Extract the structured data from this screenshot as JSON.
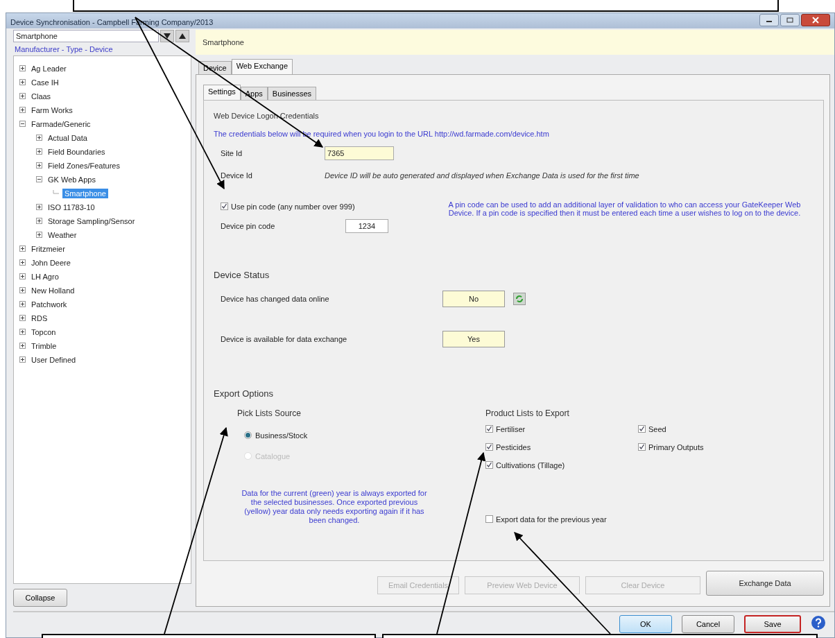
{
  "window": {
    "title": "Device Synchronisation - Campbell Farming Company/2013"
  },
  "sidebar": {
    "device_combo": {
      "value": "Smartphone"
    },
    "heading": "Manufacturer - Type - Device",
    "tree": [
      {
        "label": "Ag Leader",
        "expanded": false,
        "selected": false
      },
      {
        "label": "Case IH",
        "expanded": false,
        "selected": false
      },
      {
        "label": "Claas",
        "expanded": false,
        "selected": false
      },
      {
        "label": "Farm Works",
        "expanded": false,
        "selected": false
      },
      {
        "label": "Farmade/Generic",
        "expanded": true,
        "selected": false,
        "children": [
          {
            "label": "Actual Data",
            "expanded": false,
            "selected": false
          },
          {
            "label": "Field Boundaries",
            "expanded": false,
            "selected": false
          },
          {
            "label": "Field Zones/Features",
            "expanded": false,
            "selected": false
          },
          {
            "label": "GK Web Apps",
            "expanded": true,
            "selected": false,
            "children": [
              {
                "label": "Smartphone",
                "selected": true
              }
            ]
          },
          {
            "label": "ISO 11783-10",
            "expanded": false,
            "selected": false
          },
          {
            "label": "Storage Sampling/Sensor",
            "expanded": false,
            "selected": false
          },
          {
            "label": "Weather",
            "expanded": false,
            "selected": false
          }
        ]
      },
      {
        "label": "Fritzmeier",
        "expanded": false,
        "selected": false
      },
      {
        "label": "John Deere",
        "expanded": false,
        "selected": false
      },
      {
        "label": "LH Agro",
        "expanded": false,
        "selected": false
      },
      {
        "label": "New Holland",
        "expanded": false,
        "selected": false
      },
      {
        "label": "Patchwork",
        "expanded": false,
        "selected": false
      },
      {
        "label": "RDS",
        "expanded": false,
        "selected": false
      },
      {
        "label": "Topcon",
        "expanded": false,
        "selected": false
      },
      {
        "label": "Trimble",
        "expanded": false,
        "selected": false
      },
      {
        "label": "User Defined",
        "expanded": false,
        "selected": false
      }
    ],
    "collapse_button": "Collapse"
  },
  "header": {
    "title": "Smartphone"
  },
  "tabs": [
    {
      "label": "Device",
      "selected": false
    },
    {
      "label": "Web Exchange",
      "selected": true
    }
  ],
  "sub_tabs": [
    {
      "label": "Settings",
      "selected": true
    },
    {
      "label": "Apps",
      "selected": false
    },
    {
      "label": "Businesses",
      "selected": false
    }
  ],
  "credentials": {
    "title": "Web Device Logon Credentials",
    "note": "The credentials below will be required when you login to the URL http://wd.farmade.com/device.htm",
    "site_id": {
      "label": "Site Id",
      "value": "7365"
    },
    "device_id": {
      "label": "Device Id",
      "note": "Device ID will be auto generated and displayed when Exchange Data is used for the first time"
    },
    "use_pin": {
      "label": "Use pin code (any number over 999)",
      "checked": true
    },
    "pin": {
      "label": "Device pin code",
      "value": "1234"
    },
    "pin_note": "A pin code can be used to add an additional layer of validation to who can access your GateKeeper Web Device. If a pin code is specified then it must be entered each time a user wishes to log on to the device."
  },
  "device_status": {
    "title": "Device Status",
    "rows": [
      {
        "label": "Device has changed data online",
        "value": "No",
        "refresh": true
      },
      {
        "label": "Device is available for data exchange",
        "value": "Yes",
        "refresh": false
      }
    ]
  },
  "export_options": {
    "title": "Export Options",
    "pick_lists": {
      "title": "Pick Lists Source",
      "options": [
        {
          "label": "Business/Stock",
          "selected": true,
          "disabled": false
        },
        {
          "label": "Catalogue",
          "selected": false,
          "disabled": true
        }
      ]
    },
    "note": "Data for the current (green) year is always exported for the selected businesses. Once exported previous (yellow) year data only needs exporting again if it has been changed.",
    "product_lists": {
      "title": "Product Lists to Export",
      "items": [
        {
          "label": "Fertiliser",
          "checked": true
        },
        {
          "label": "Seed",
          "checked": true
        },
        {
          "label": "Pesticides",
          "checked": true
        },
        {
          "label": "Primary Outputs",
          "checked": true
        },
        {
          "label": "Cultivations (Tillage)",
          "checked": true
        }
      ]
    },
    "previous_year": {
      "label": "Export data for the previous year",
      "checked": false
    }
  },
  "actions": [
    {
      "label": "Email Credentials",
      "disabled": true
    },
    {
      "label": "Preview Web Device",
      "disabled": true
    },
    {
      "label": "Clear Device",
      "disabled": true
    },
    {
      "label": "Exchange Data",
      "disabled": false
    }
  ],
  "dialog_buttons": [
    {
      "label": "OK",
      "kind": "default"
    },
    {
      "label": "Cancel",
      "kind": "normal"
    },
    {
      "label": "Save",
      "kind": "highlighted"
    }
  ]
}
